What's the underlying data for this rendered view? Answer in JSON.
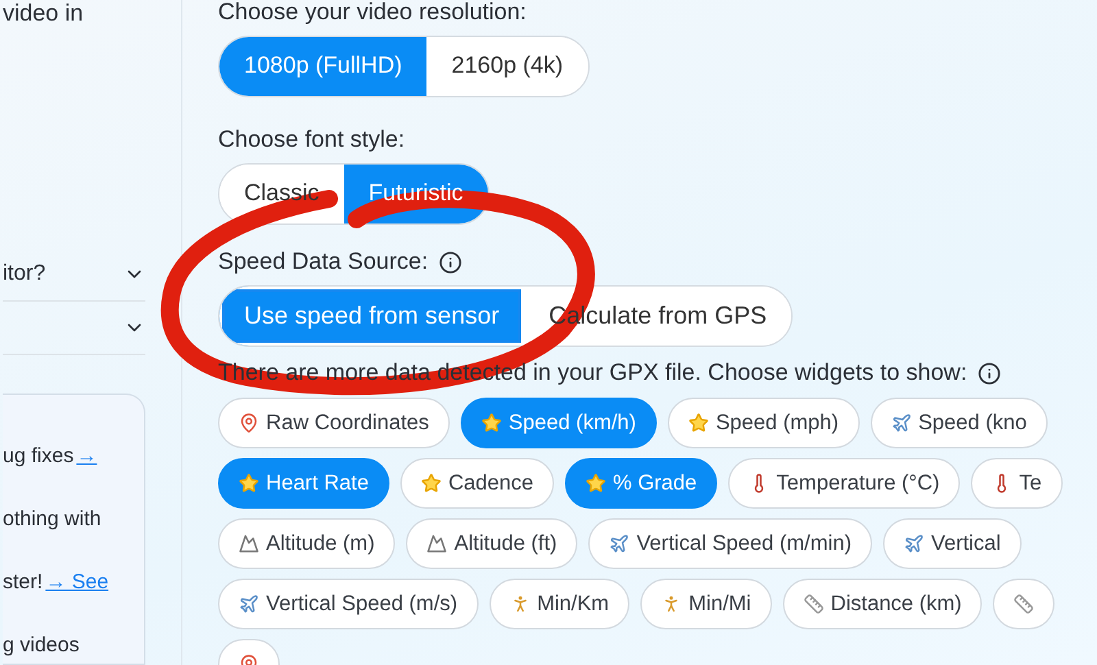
{
  "sidebar": {
    "intro_text": "video in",
    "faq": [
      {
        "question": "itor?",
        "expanded": false
      },
      {
        "expanded": false
      }
    ],
    "news_card": {
      "lines": [
        {
          "text": "ug fixes",
          "link": "→"
        },
        {
          "text": "othing with"
        },
        {
          "text": "ster!",
          "link": "→ See"
        },
        {
          "text": "g videos"
        }
      ]
    }
  },
  "resolution": {
    "label": "Choose your video resolution:",
    "options": [
      {
        "label": "1080p (FullHD)",
        "selected": true
      },
      {
        "label": "2160p (4k)",
        "selected": false
      }
    ]
  },
  "font_style": {
    "label": "Choose font style:",
    "options": [
      {
        "label": "Classic",
        "selected": false
      },
      {
        "label": "Futuristic",
        "selected": true
      }
    ]
  },
  "speed_source": {
    "label": "Speed Data Source:",
    "options": [
      {
        "label": "Use speed from sensor",
        "selected": true
      },
      {
        "label": "Calculate from GPS",
        "selected": false
      }
    ]
  },
  "widgets": {
    "label": "There are more data detected in your GPX file. Choose widgets to show:",
    "rows": [
      [
        {
          "label": "Raw Coordinates",
          "kind": "pin",
          "selected": false
        },
        {
          "label": "Speed (km/h)",
          "kind": "star",
          "selected": true
        },
        {
          "label": "Speed (mph)",
          "kind": "star",
          "selected": false
        },
        {
          "label": "Speed (kno",
          "kind": "plane",
          "selected": false
        }
      ],
      [
        {
          "label": "Heart Rate",
          "kind": "star",
          "selected": true
        },
        {
          "label": "Cadence",
          "kind": "star",
          "selected": false
        },
        {
          "label": "% Grade",
          "kind": "star",
          "selected": true
        },
        {
          "label": "Temperature (°C)",
          "kind": "thermo",
          "selected": false
        },
        {
          "label": "Te",
          "kind": "thermo",
          "selected": false
        }
      ],
      [
        {
          "label": "Altitude (m)",
          "kind": "mountain",
          "selected": false
        },
        {
          "label": "Altitude (ft)",
          "kind": "mountain",
          "selected": false
        },
        {
          "label": "Vertical Speed (m/min)",
          "kind": "plane",
          "selected": false
        },
        {
          "label": "Vertical",
          "kind": "plane",
          "selected": false
        }
      ],
      [
        {
          "label": "Vertical Speed (m/s)",
          "kind": "plane",
          "selected": false
        },
        {
          "label": "Min/Km",
          "kind": "runner",
          "selected": false
        },
        {
          "label": "Min/Mi",
          "kind": "runner",
          "selected": false
        },
        {
          "label": "Distance (km)",
          "kind": "ruler",
          "selected": false
        },
        {
          "kind": "ruler",
          "selected": false
        }
      ],
      [
        {
          "kind": "pin",
          "selected": false
        }
      ]
    ]
  }
}
